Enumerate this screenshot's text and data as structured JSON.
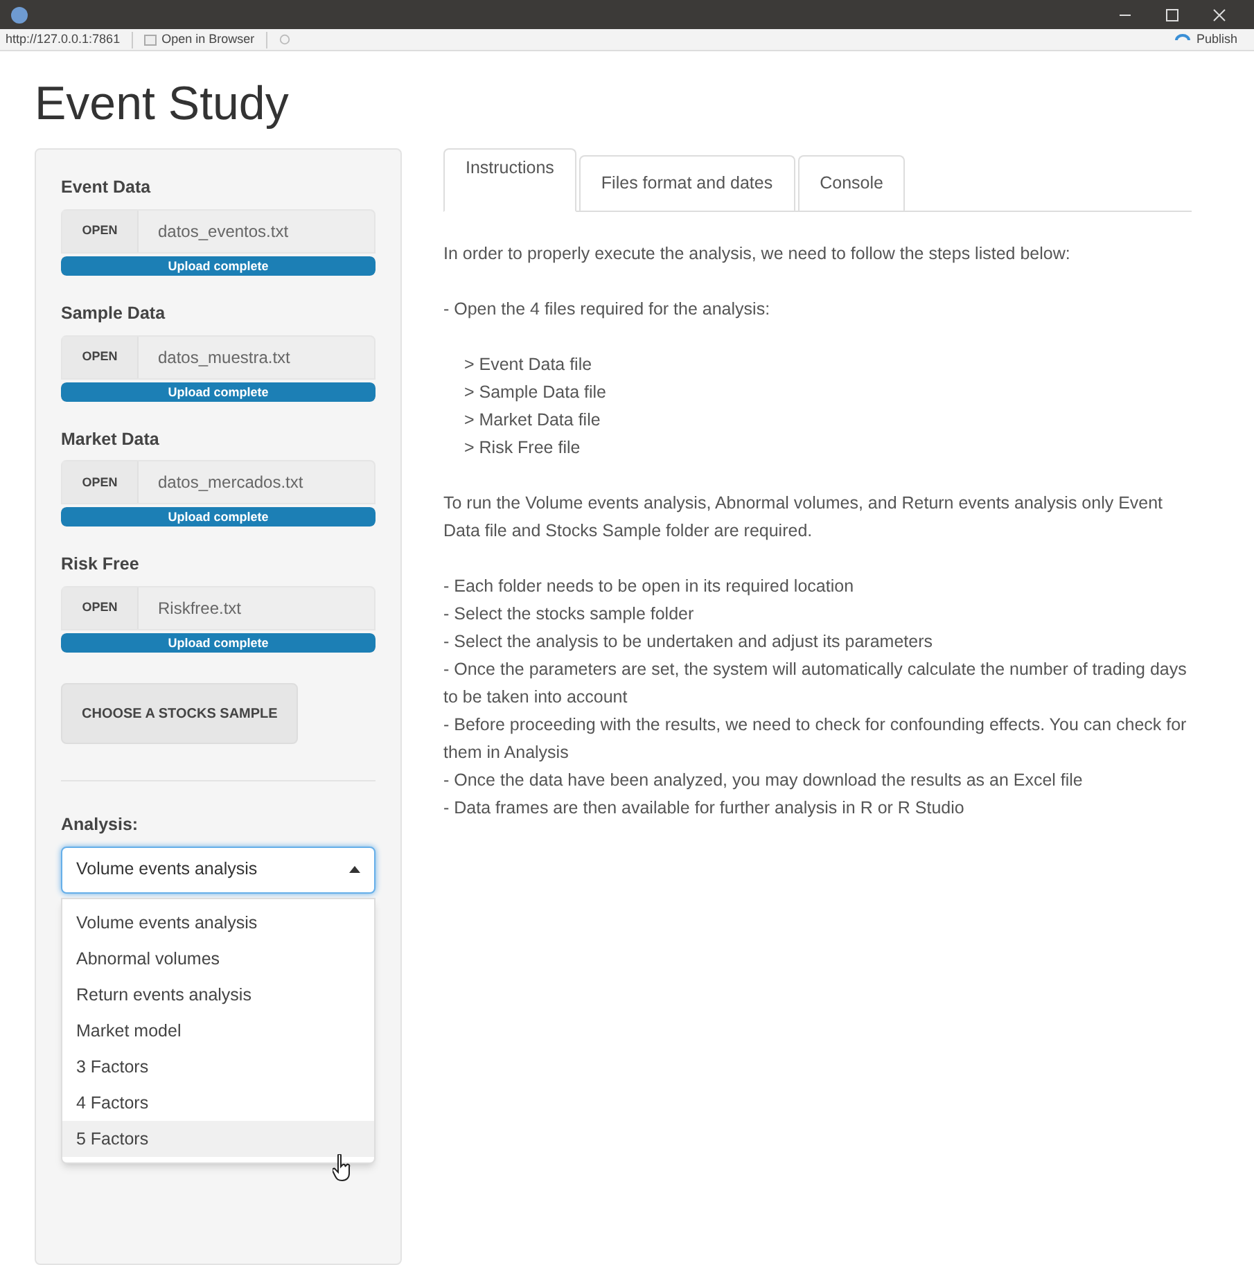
{
  "toolbar": {
    "url": "http://127.0.0.1:7861",
    "open_in_browser": "Open in Browser",
    "publish": "Publish"
  },
  "page_title": "Event Study",
  "file_inputs": [
    {
      "label": "Event Data",
      "button": "OPEN",
      "filename": "datos_eventos.txt",
      "status": "Upload complete",
      "level": 1
    },
    {
      "label": "Sample Data",
      "button": "OPEN",
      "filename": "datos_muestra.txt",
      "status": "Upload complete",
      "level": 1
    },
    {
      "label": "Market Data",
      "button": "OPEN",
      "filename": "datos_mercados.txt",
      "status": "Upload complete",
      "level": 1
    },
    {
      "label": "Risk Free",
      "button": "OPEN",
      "filename": "Riskfree.txt",
      "status": "Upload complete",
      "level": 1
    }
  ],
  "choose_button": "CHOOSE A STOCKS SAMPLE",
  "analysis": {
    "label": "Analysis:",
    "value": "Volume events analysis",
    "expanded": true,
    "options": [
      {
        "label": "Volume events analysis",
        "highlighted": false
      },
      {
        "label": "Abnormal volumes",
        "highlighted": false
      },
      {
        "label": "Return events analysis",
        "highlighted": false
      },
      {
        "label": "Market model",
        "highlighted": false
      },
      {
        "label": "3 Factors",
        "highlighted": false
      },
      {
        "label": "4 Factors",
        "highlighted": false
      },
      {
        "label": "5 Factors",
        "highlighted": true
      }
    ]
  },
  "tabs": [
    {
      "label": "Instructions",
      "selected": true
    },
    {
      "label": "Files format and dates",
      "selected": false
    },
    {
      "label": "Console",
      "selected": false
    }
  ],
  "instructions": [
    {
      "kind": "lines",
      "items": [
        "In order to properly execute the analysis, we need to follow the steps listed below:"
      ]
    },
    {
      "kind": "lines",
      "items": [
        "- Open the 4 files required for the analysis:"
      ]
    },
    {
      "kind": "indented",
      "items": [
        "> Event Data file",
        "> Sample Data file",
        "> Market Data file",
        "> Risk Free file"
      ]
    },
    {
      "kind": "lines",
      "items": [
        "To run the Volume events analysis, Abnormal volumes, and Return events analysis only Event Data file and Stocks Sample folder are required."
      ]
    },
    {
      "kind": "lines",
      "items": [
        "- Each folder needs to be open in its required location",
        "- Select the stocks sample folder",
        "- Select the analysis to be undertaken and adjust its parameters",
        "- Once the parameters are set, the system will automatically calculate the number of trading days to be taken into account",
        "- Before proceeding with the results, we need to check for confounding effects. You can check for them in Analysis",
        "- Once the data have been analyzed, you may download the results as an Excel file",
        "- Data frames are then available for further analysis in R or R Studio"
      ]
    }
  ]
}
